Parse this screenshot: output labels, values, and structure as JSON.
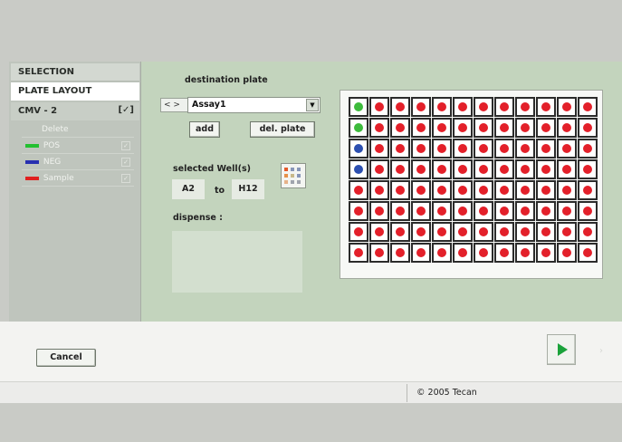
{
  "sidebar": {
    "selection": "SELECTION",
    "plate_layout": "PLATE LAYOUT",
    "assay": "CMV - 2",
    "assay_check": "[✓]",
    "items": [
      {
        "label": "Delete"
      },
      {
        "label": "POS",
        "color": "#22c030"
      },
      {
        "label": "NEG",
        "color": "#2830b0"
      },
      {
        "label": "Sample",
        "color": "#e02020"
      }
    ]
  },
  "destination": {
    "label": "destination plate",
    "nav": "< >",
    "plate_name": "Assay1",
    "add_label": "add",
    "delete_label": "del. plate"
  },
  "wells": {
    "selected_label": "selected  Well(s)",
    "from": "A2",
    "to_label": "to",
    "to": "H12",
    "dispense_label": "dispense :"
  },
  "plate": {
    "rows": 8,
    "columns": 12,
    "colors": {
      "pos": "#3dbb3c",
      "neg": "#2c4fb0",
      "sample": "#e3202a"
    },
    "layout": [
      [
        "pos",
        "sample",
        "sample",
        "sample",
        "sample",
        "sample",
        "sample",
        "sample",
        "sample",
        "sample",
        "sample",
        "sample"
      ],
      [
        "pos",
        "sample",
        "sample",
        "sample",
        "sample",
        "sample",
        "sample",
        "sample",
        "sample",
        "sample",
        "sample",
        "sample"
      ],
      [
        "neg",
        "sample",
        "sample",
        "sample",
        "sample",
        "sample",
        "sample",
        "sample",
        "sample",
        "sample",
        "sample",
        "sample"
      ],
      [
        "neg",
        "sample",
        "sample",
        "sample",
        "sample",
        "sample",
        "sample",
        "sample",
        "sample",
        "sample",
        "sample",
        "sample"
      ],
      [
        "sample",
        "sample",
        "sample",
        "sample",
        "sample",
        "sample",
        "sample",
        "sample",
        "sample",
        "sample",
        "sample",
        "sample"
      ],
      [
        "sample",
        "sample",
        "sample",
        "sample",
        "sample",
        "sample",
        "sample",
        "sample",
        "sample",
        "sample",
        "sample",
        "sample"
      ],
      [
        "sample",
        "sample",
        "sample",
        "sample",
        "sample",
        "sample",
        "sample",
        "sample",
        "sample",
        "sample",
        "sample",
        "sample"
      ],
      [
        "sample",
        "sample",
        "sample",
        "sample",
        "sample",
        "sample",
        "sample",
        "sample",
        "sample",
        "sample",
        "sample",
        "sample"
      ]
    ]
  },
  "footer": {
    "cancel_label": "Cancel",
    "copyright": "© 2005 Tecan"
  }
}
